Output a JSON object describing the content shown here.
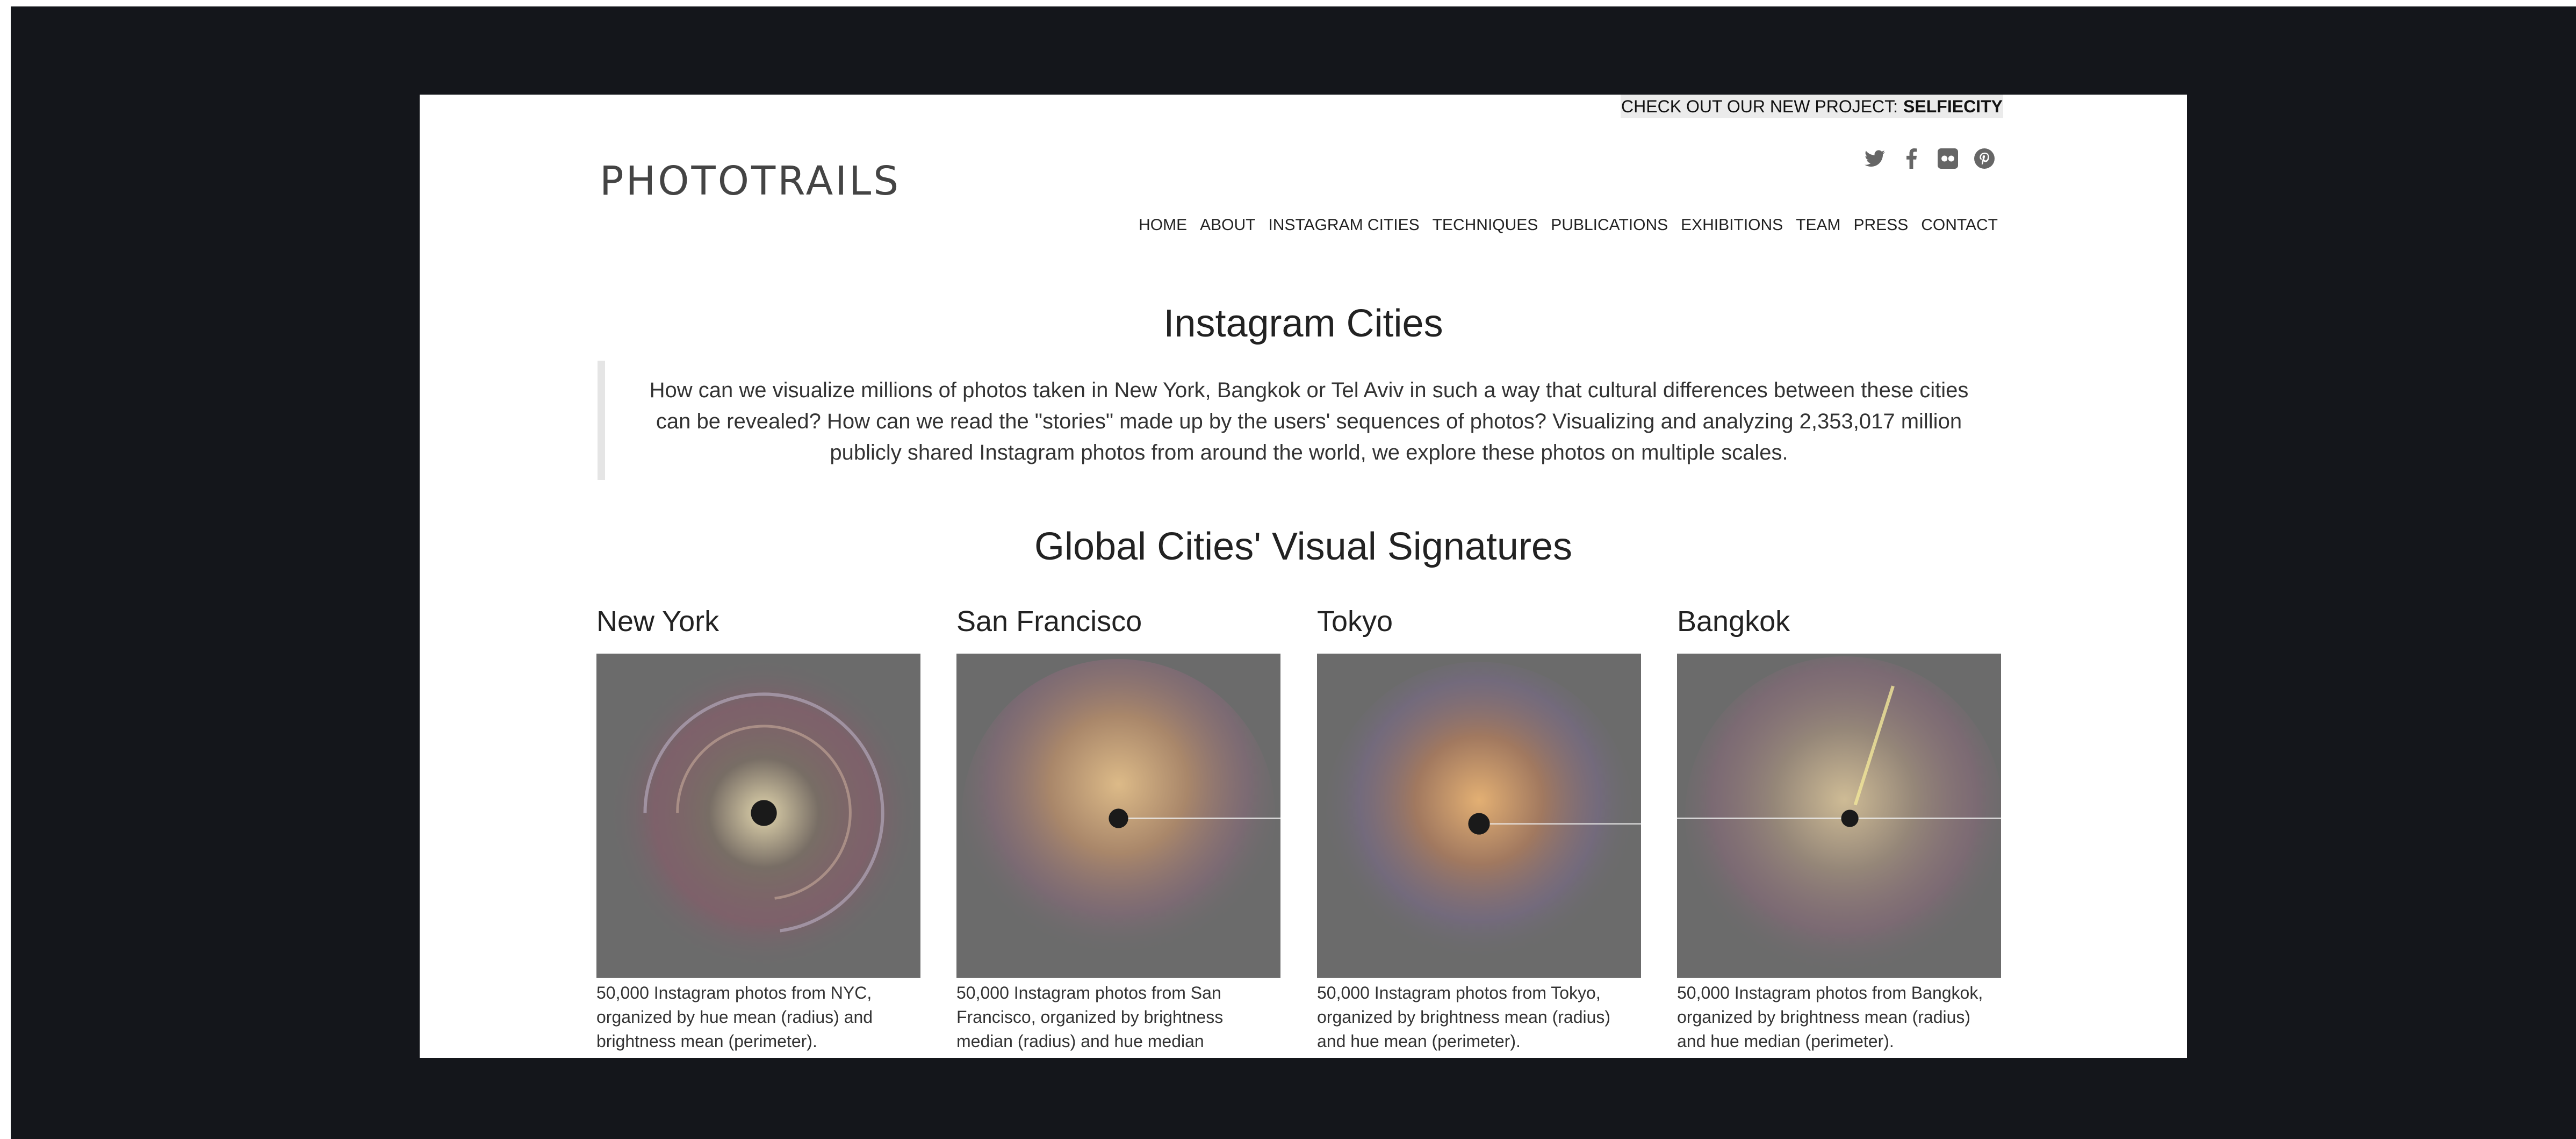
{
  "promo": {
    "text": "CHECK OUT OUR NEW PROJECT:",
    "link": "SELFIECITY"
  },
  "logo": "PHOTOTRAILS",
  "social": [
    "twitter-icon",
    "facebook-icon",
    "flickr-icon",
    "pinterest-icon"
  ],
  "nav": [
    "HOME",
    "ABOUT",
    "INSTAGRAM CITIES",
    "TECHNIQUES",
    "PUBLICATIONS",
    "EXHIBITIONS",
    "TEAM",
    "PRESS",
    "CONTACT"
  ],
  "title": "Instagram Cities",
  "intro": "How can we visualize millions of photos taken in New York, Bangkok or Tel Aviv in such a way that cultural differences between these cities can be revealed? How can we read the \"stories\" made up by the users' sequences of photos? Visualizing and analyzing 2,353,017 million publicly shared Instagram photos from around the world, we explore these photos on multiple scales.",
  "section_title": "Global Cities' Visual Signatures",
  "cities": [
    {
      "name": "New York",
      "caption": "50,000 Instagram photos from NYC, organized by hue mean (radius) and brightness mean (perimeter)."
    },
    {
      "name": "San Francisco",
      "caption": "50,000 Instagram photos from San Francisco, organized by brightness median (radius) and hue median"
    },
    {
      "name": "Tokyo",
      "caption": "50,000 Instagram photos from Tokyo, organized by brightness mean (radius) and hue mean (perimeter)."
    },
    {
      "name": "Bangkok",
      "caption": "50,000 Instagram photos from Bangkok, organized by brightness mean (radius) and hue median (perimeter)."
    }
  ]
}
